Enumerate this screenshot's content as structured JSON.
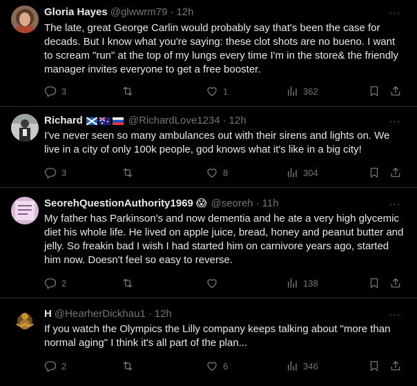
{
  "tweets": [
    {
      "name": "Gloria Hayes",
      "handle": "@glwwrm79",
      "sep": "·",
      "time": "12h",
      "text": "The late, great George Carlin would probably say that's been the case for decads. But I know what you're saying: these clot shots are no bueno. I want to scream \"run\" at the top of my lungs every time I'm in the store& the friendly manager invites everyone to get a free booster.",
      "replies": "3",
      "retweets": "",
      "likes": "1",
      "views": "362"
    },
    {
      "name": "Richard",
      "name_flags": "🏴󠁧󠁢󠁳󠁣󠁴󠁿🇦🇺🇷🇺",
      "handle": "@RichardLove1234",
      "sep": "·",
      "time": "12h",
      "text": "I've never seen so many ambulances out with their sirens and lights on. We live in a city of only 100k people, god knows what it's like in a big city!",
      "replies": "3",
      "retweets": "",
      "likes": "8",
      "views": "304"
    },
    {
      "name": "SeorehQuestionAuthority1969",
      "name_emoji": "😱",
      "handle": "@seoreh",
      "sep": "·",
      "time": "11h",
      "text": "My father has Parkinson's and now dementia and he ate a very high glycemic diet his whole life. He lived on apple juice, bread, honey and peanut butter and jelly. So freakin bad I wish I had started him on carnivore years ago, started him now. Doesn't feel so easy to reverse.",
      "replies": "2",
      "retweets": "",
      "likes": "",
      "views": "138"
    },
    {
      "name": "H",
      "handle": "@HearherDickhau1",
      "sep": "·",
      "time": "12h",
      "text": "If you watch the Olympics the Lilly company keeps talking about \"more than normal aging\" I think it's all part of the plan...",
      "replies": "2",
      "retweets": "",
      "likes": "6",
      "views": "346"
    }
  ],
  "more_glyph": "···",
  "icons": [
    "reply-icon",
    "retweet-icon",
    "like-icon",
    "views-icon",
    "bookmark-icon",
    "share-icon",
    "more-icon"
  ],
  "colors": {
    "background": "#000000",
    "text": "#e7e9ea",
    "muted": "#71767b",
    "divider": "#2f3336"
  }
}
